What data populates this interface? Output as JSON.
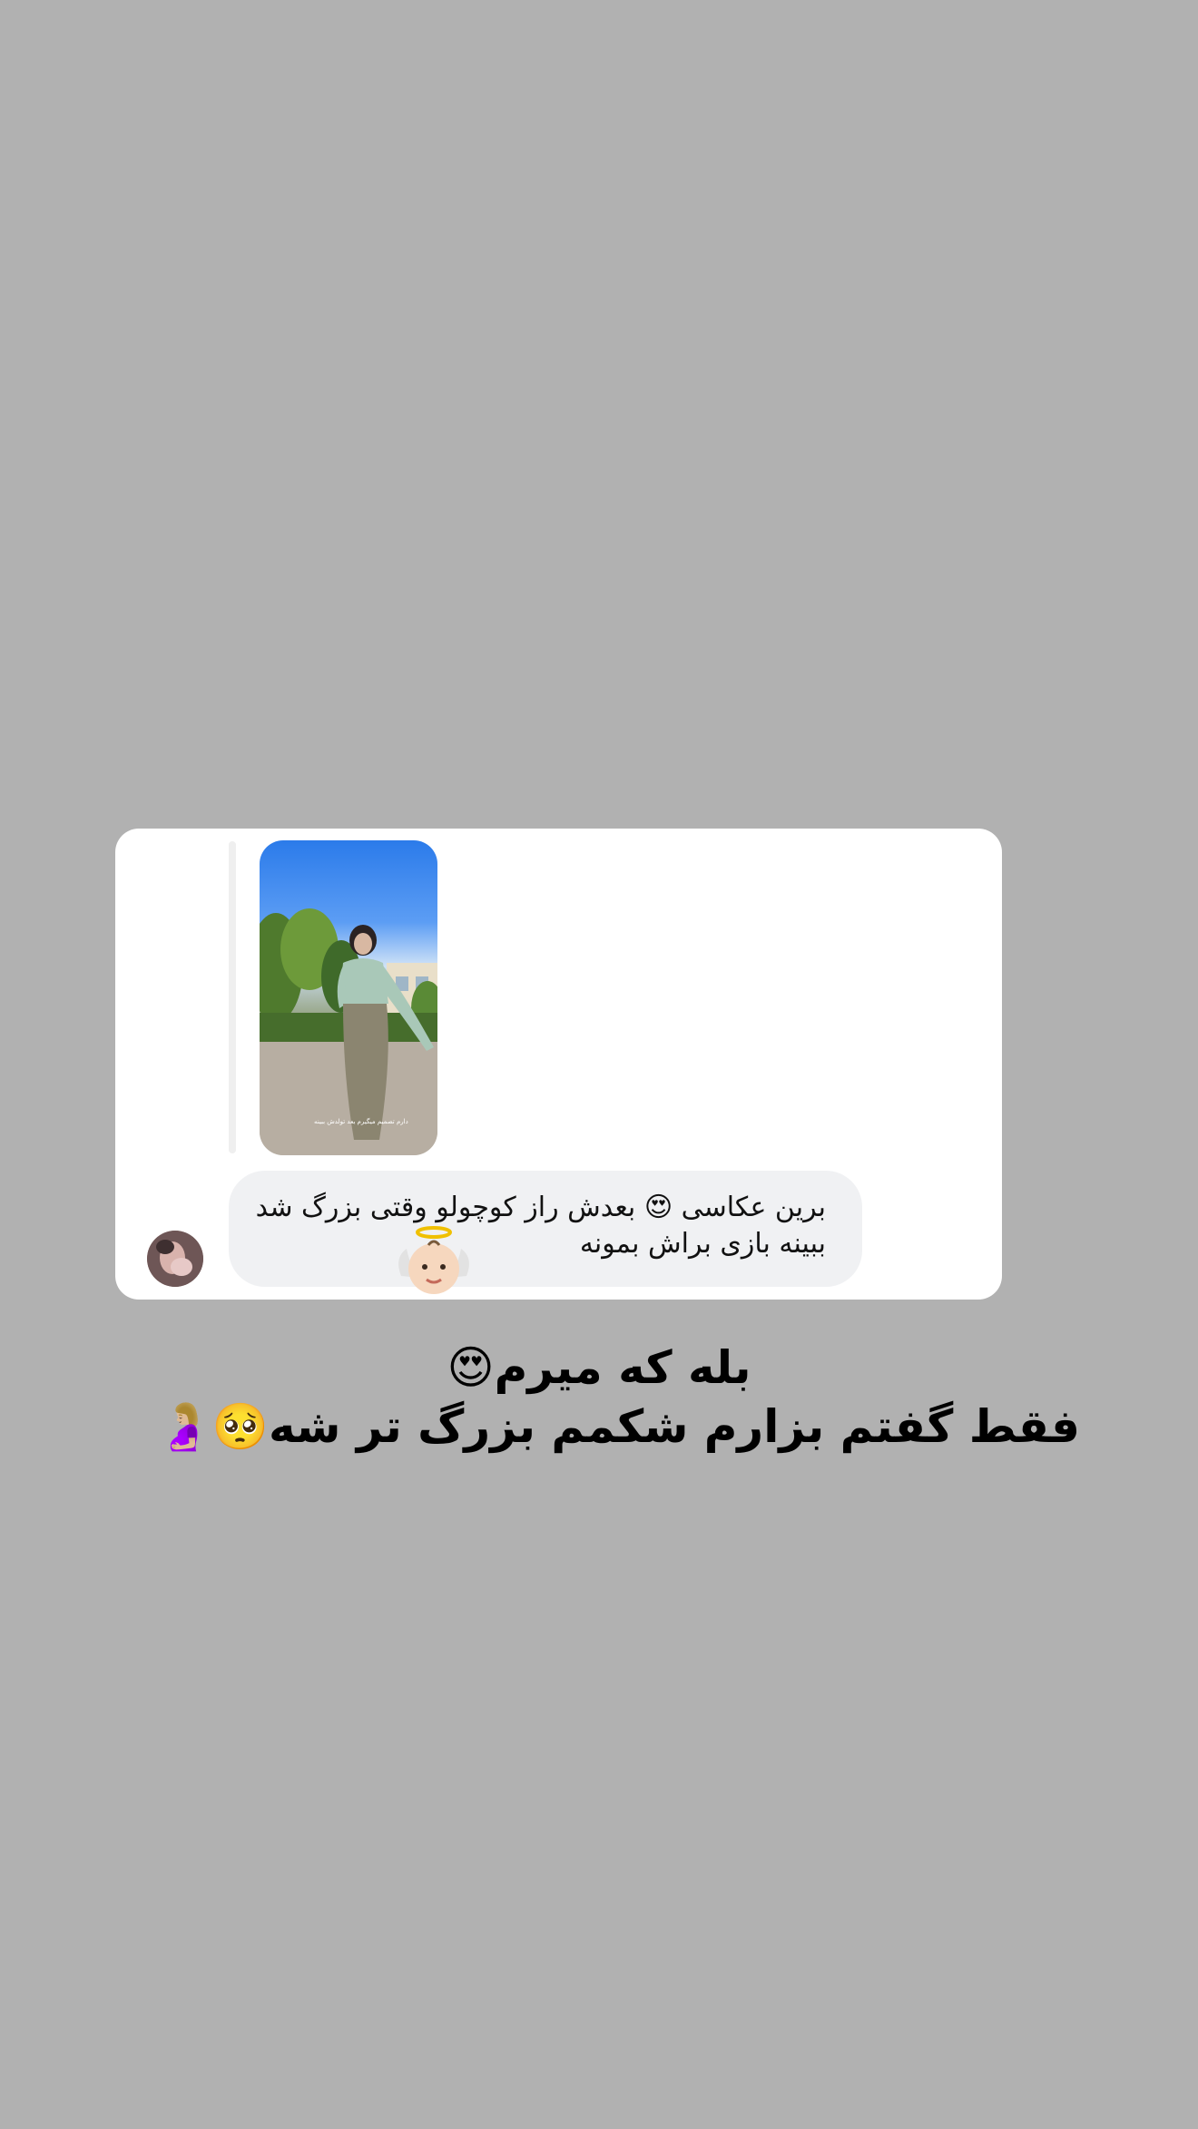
{
  "reply": {
    "comment_line_1": "برین عکاسی 😍 بعدش راز کوچولو وقتی بزرگ شد",
    "comment_line_2": "ببینه بازی براش بمونه",
    "story_overlay_text": "دارم تصمیم میگیرم بعد تولدش ببینه"
  },
  "caption": {
    "line_1": "بله که میرم😍",
    "line_2": "فقط گفتم بزارم شکمم بزرگ تر شه🥺🤰🏼"
  },
  "icons": {
    "angel": "baby-angel-emoji",
    "avatar": "user-avatar"
  },
  "colors": {
    "background": "#b1b1b1",
    "card": "#ffffff",
    "bubble": "#f0f1f3"
  }
}
